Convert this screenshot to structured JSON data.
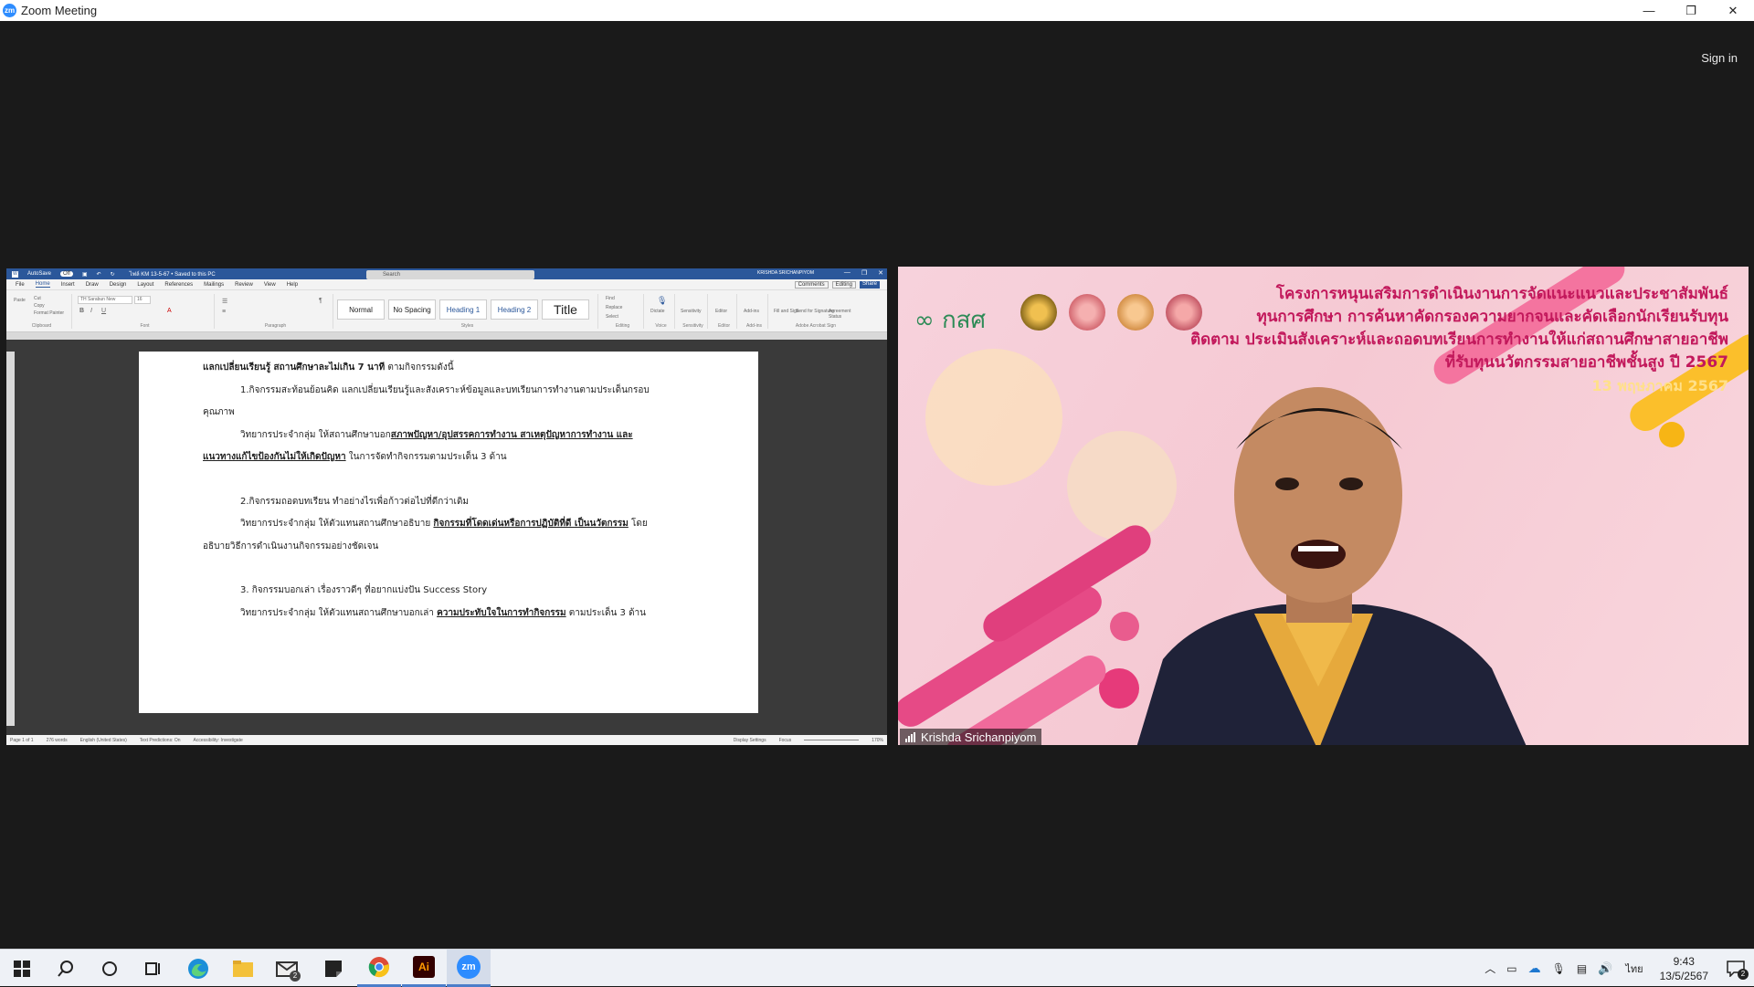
{
  "window": {
    "title": "Zoom Meeting",
    "logo": "zm"
  },
  "window_controls": {
    "minimize": "—",
    "restore": "❐",
    "close": "✕"
  },
  "signin": "Sign in",
  "word": {
    "autosave": "AutoSave",
    "autosave_state": "Off",
    "doc_title": "ไฟล์ KM 13-5-67 • Saved to this PC",
    "search_placeholder": "Search",
    "user": "KRISHDA SRICHANPIYOM",
    "menu": [
      "File",
      "Home",
      "Insert",
      "Draw",
      "Design",
      "Layout",
      "References",
      "Mailings",
      "Review",
      "View",
      "Help"
    ],
    "menu_active": "Home",
    "buttons": {
      "comments": "Comments",
      "editing": "Editing",
      "share": "Share"
    },
    "font_name": "TH Sarabun New",
    "font_size": "16",
    "ribbon_groups": [
      "Clipboard",
      "Font",
      "Paragraph",
      "Styles",
      "Editing",
      "Voice",
      "Sensitivity",
      "Editor",
      "Add-ins",
      "Adobe Acrobat Sign"
    ],
    "clipboard_items": [
      "Paste",
      "Cut",
      "Copy",
      "Format Painter"
    ],
    "styles": [
      "Normal",
      "No Spacing",
      "Heading 1",
      "Heading 2",
      "Title"
    ],
    "editing_items": [
      "Find",
      "Replace",
      "Select"
    ],
    "right_tools": [
      "Dictate",
      "Sensitivity",
      "Editor",
      "Add-ins",
      "Fill and Sign",
      "Send for Signature",
      "Agreement Status"
    ],
    "doc_lines": [
      {
        "a": "แลกเปลี่ยนเรียนรู้ สถานศึกษาละไม่เกิน 7 นาที",
        "b": " ตามกิจกรรมดังนี้"
      },
      {
        "a": "1.กิจกรรมสะท้อนย้อนคิด แลกเปลี่ยนเรียนรู้และสังเคราะห์ข้อมูลและบทเรียนการทำงานตามประเด็นกรอบ"
      },
      {
        "a": "คุณภาพ"
      },
      {
        "a": "วิทยากรประจำกลุ่ม  ให้สถานศึกษาบอก",
        "u": "สภาพปัญหา/อุปสรรคการทำงาน สาเหตุปัญหาการทำงาน และ"
      },
      {
        "u": "แนวทางแก้ไขป้องกันไม่ให้เกิดปัญหา",
        "b": " ในการจัดทำกิจกรรมตามประเด็น 3 ด้าน"
      },
      {
        "a": "2.กิจกรรมถอดบทเรียน ทำอย่างไรเพื่อก้าวต่อไปที่ดีกว่าเดิม"
      },
      {
        "a": "วิทยากรประจำกลุ่ม ให้ตัวแทนสถานศึกษาอธิบาย ",
        "u": "กิจกรรมที่โดดเด่นหรือการปฏิบัติที่ดี เป็นนวัตกรรม",
        "b": " โดย"
      },
      {
        "a": "อธิบายวิธีการดำเนินงานกิจกรรมอย่างชัดเจน"
      },
      {
        "a": "3. กิจกรรมบอกเล่า เรื่องราวดีๆ ที่อยากแบ่งปัน Success Story"
      },
      {
        "a": "วิทยากรประจำกลุ่ม ให้ตัวแทนสถานศึกษาบอกเล่า ",
        "u": "ความประทับใจในการทำกิจกรรม",
        "b": " ตามประเด็น 3 ด้าน"
      }
    ],
    "status": {
      "page": "Page 1 of 1",
      "words": "276 words",
      "language": "English (United States)",
      "predictions": "Text Predictions: On",
      "accessibility": "Accessibility: Investigate",
      "display": "Display Settings",
      "focus": "Focus",
      "zoom": "170%"
    }
  },
  "video": {
    "participant": "Krishda Srichanpiyom",
    "logo_text": "กสศ",
    "banner": [
      "โครงการหนุนเสริมการดำเนินงานการจัดแนะแนวและประชาสัมพันธ์",
      "ทุนการศึกษา การค้นหาคัดกรองความยากจนและคัดเลือกนักเรียนรับทุน",
      "ติดตาม ประเมินสังเคราะห์และถอดบทเรียนการทำงานให้แก่สถานศึกษาสายอาชีพ",
      "ที่รับทุนนวัตกรรมสายอาชีพชั้นสูง ปี 2567"
    ],
    "date": "13  พฤษภาคม 2567"
  },
  "taskbar": {
    "apps": [
      "start-icon",
      "search-icon",
      "cortana-icon",
      "task-view-icon",
      "edge-icon",
      "file-explorer-icon",
      "mail-icon",
      "sticky-notes-icon",
      "chrome-icon",
      "illustrator-icon",
      "zoom-icon"
    ],
    "mail_badge": "2",
    "illustrator_label": "Ai",
    "zoom_label": "zm",
    "ime": "ไทย",
    "time": "9:43",
    "date": "13/5/2567",
    "notif_badge": "2"
  },
  "colors": {
    "word_blue": "#2b579a",
    "zoom_blue": "#2d8cff",
    "banner_pink": "#c2185b",
    "stage": "#1a1a1a"
  }
}
